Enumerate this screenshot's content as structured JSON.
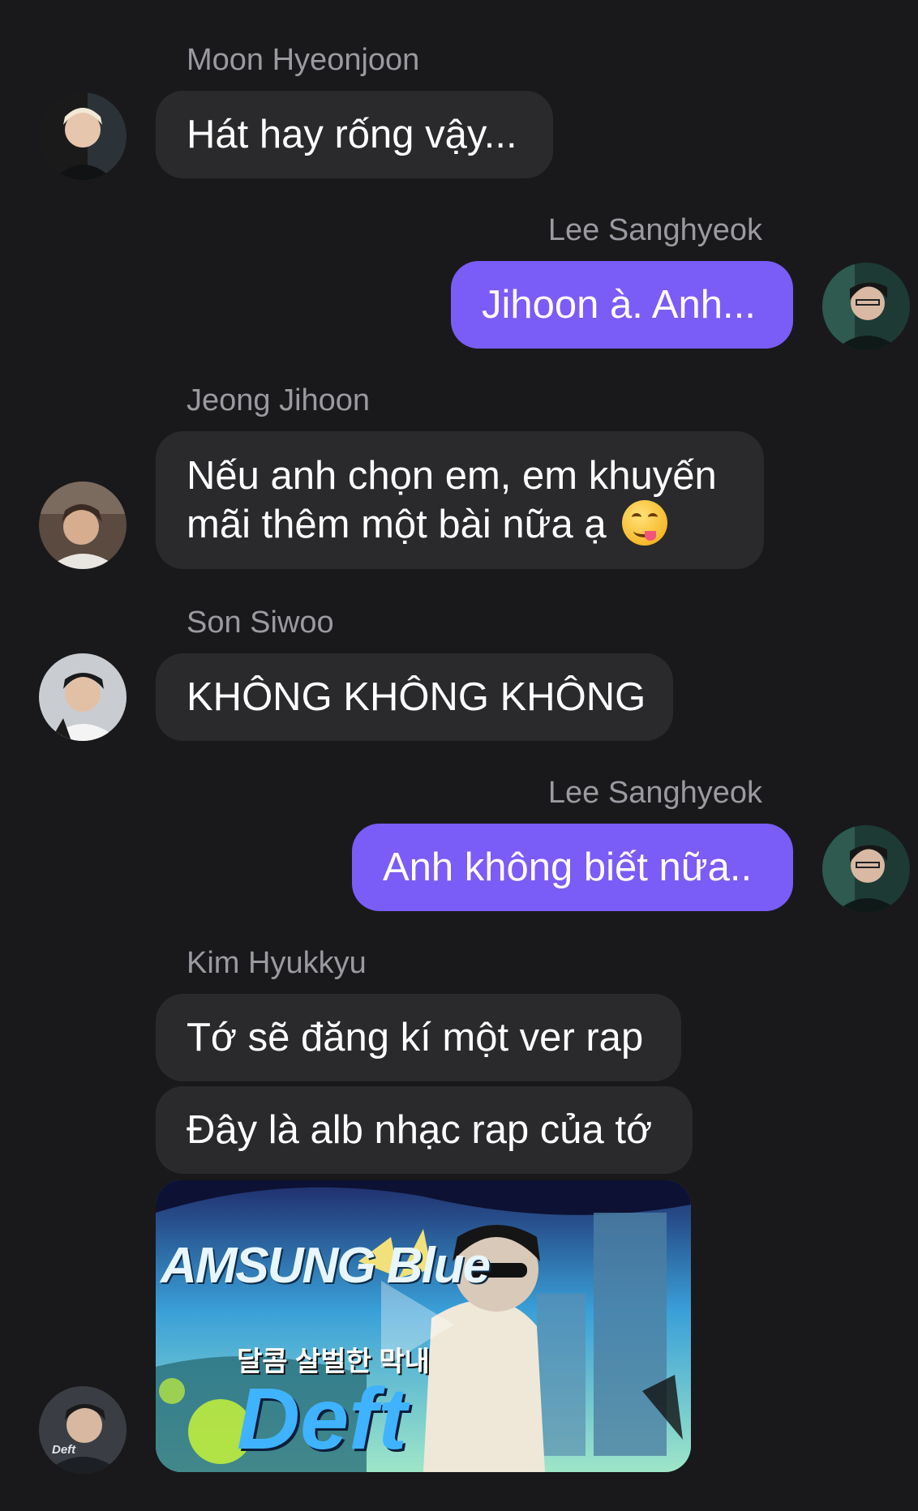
{
  "messages": [
    {
      "sender": "Moon Hyeonjoon",
      "text": "Hát hay rống vậy..."
    },
    {
      "sender": "Lee Sanghyeok",
      "text": "Jihoon à. Anh..."
    },
    {
      "sender": "Jeong Jihoon",
      "line1": "Nếu anh chọn em, em khuyến",
      "line2": "mãi thêm một bài nữa ạ",
      "emoji": "face-savoring-food-emoji"
    },
    {
      "sender": "Son Siwoo",
      "text": "KHÔNG KHÔNG KHÔNG"
    },
    {
      "sender": "Lee Sanghyeok",
      "text": "Anh không biết nữa.."
    },
    {
      "sender": "Kim Hyukkyu",
      "texts": [
        "Tớ sẽ đăng kí một ver rap",
        "Đây là alb nhạc rap của tớ"
      ]
    }
  ],
  "media": {
    "banner_text": "AMSUNG Blue",
    "korean_text": "달콤 살벌한 막내",
    "name_text": "Deft",
    "icon": "play-icon"
  },
  "avatar_label": "Deft",
  "colors": {
    "background": "#19191b",
    "bubble_other": "#2a2a2d",
    "bubble_mine": "#7a5cf7",
    "sender_name": "#9a9aa0"
  }
}
